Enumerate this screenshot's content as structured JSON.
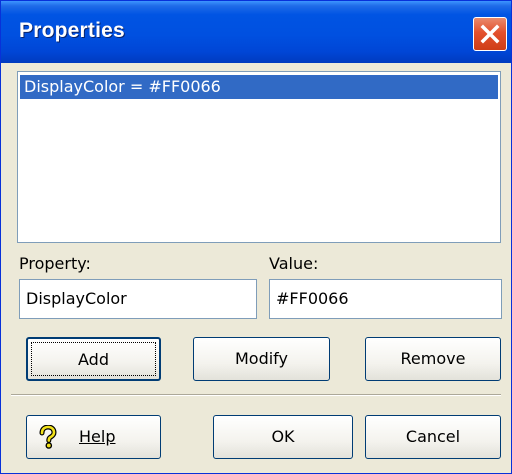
{
  "window": {
    "title": "Properties"
  },
  "list": {
    "items": [
      "DisplayColor = #FF0066"
    ]
  },
  "property": {
    "label": "Property:",
    "value": "DisplayColor"
  },
  "value": {
    "label": "Value:",
    "value": "#FF0066"
  },
  "buttons": {
    "add": "Add",
    "modify": "Modify",
    "remove": "Remove",
    "help": "Help",
    "ok": "OK",
    "cancel": "Cancel"
  },
  "icons": {
    "close": "close-icon",
    "help": "question-mark-icon"
  },
  "colors": {
    "title_bar": "#0054e3",
    "selection": "#316ac5",
    "dialog_bg": "#ece9d8",
    "close_button": "#e3502d"
  }
}
